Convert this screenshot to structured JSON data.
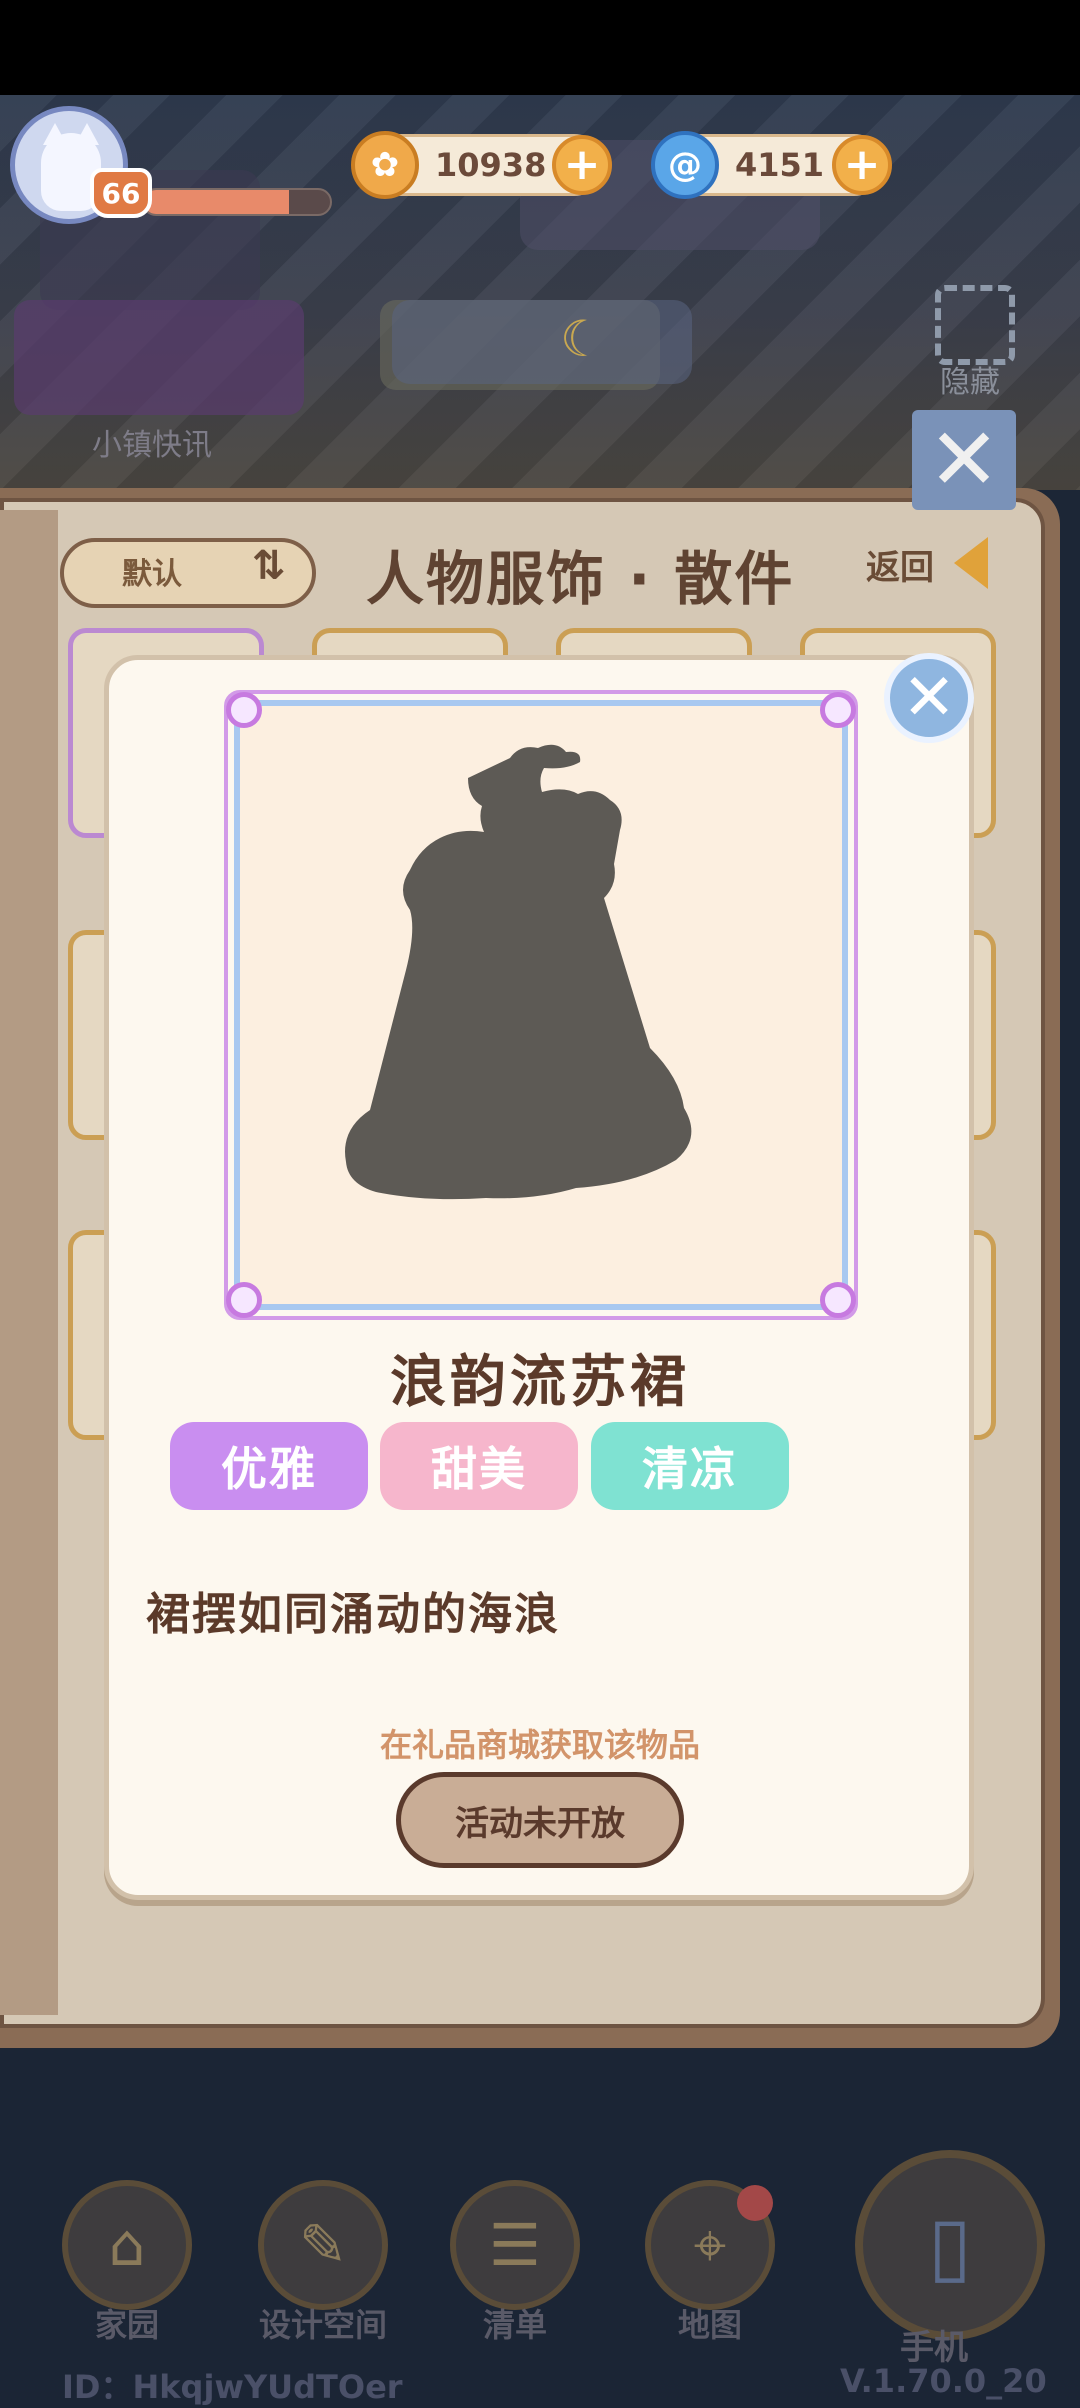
{
  "hud": {
    "level": "66",
    "xp_progress": 0.78,
    "coins": "10938",
    "gems": "4151",
    "news_label": "小镇快讯",
    "hide_label": "隐藏"
  },
  "panel": {
    "sort_label": "默认",
    "title": "人物服饰 · 散件",
    "back_label": "返回"
  },
  "item": {
    "name": "浪韵流苏裙",
    "tags": [
      "优雅",
      "甜美",
      "清凉"
    ],
    "tag_colors": [
      "#c98ef0",
      "#f6b6cc",
      "#7fe2d2"
    ],
    "description": "裙摆如同涌动的海浪",
    "source": "在礼品商城获取该物品",
    "action_label": "活动未开放"
  },
  "bottom_nav": {
    "items": [
      {
        "label": "家园",
        "icon": "home-icon"
      },
      {
        "label": "设计空间",
        "icon": "design-icon"
      },
      {
        "label": "清单",
        "icon": "list-icon"
      },
      {
        "label": "地图",
        "icon": "map-pin-icon"
      },
      {
        "label": "手机",
        "icon": "phone-icon"
      }
    ],
    "user_id": "ID：HkqjwYUdTOer",
    "version": "V.1.70.0_20"
  }
}
